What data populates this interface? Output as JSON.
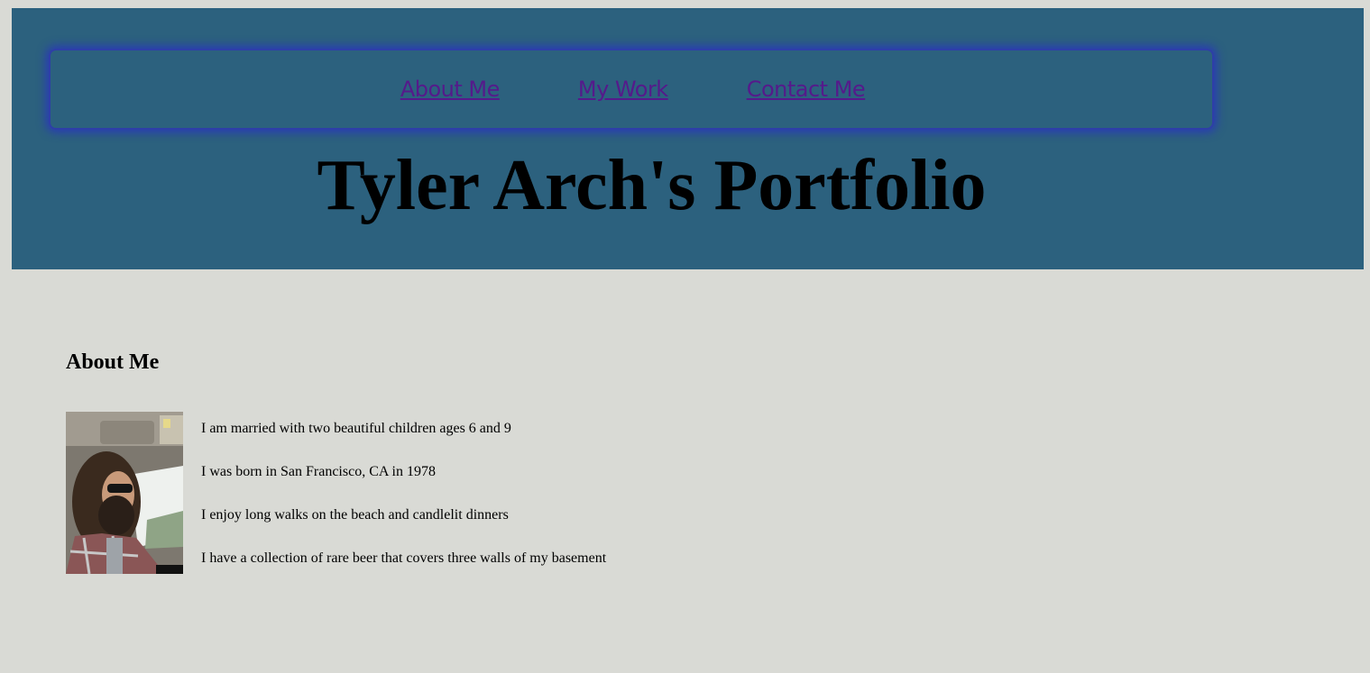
{
  "nav": {
    "links": [
      {
        "label": "About Me"
      },
      {
        "label": "My Work"
      },
      {
        "label": "Contact Me"
      }
    ]
  },
  "header": {
    "title": "Tyler Arch's Portfolio",
    "background": "#2c617e"
  },
  "about": {
    "heading": "About Me",
    "photo_alt": "profile-photo",
    "facts": [
      "I am married with two beautiful children ages 6 and 9",
      "I was born in San Francisco, CA in 1978",
      "I enjoy long walks on the beach and candlelit dinners",
      "I have a collection of rare beer that covers three walls of my basement"
    ]
  },
  "colors": {
    "page_background": "#d9dad5",
    "link_visited": "#551a8b",
    "nav_glow": "#2e3ea8"
  }
}
